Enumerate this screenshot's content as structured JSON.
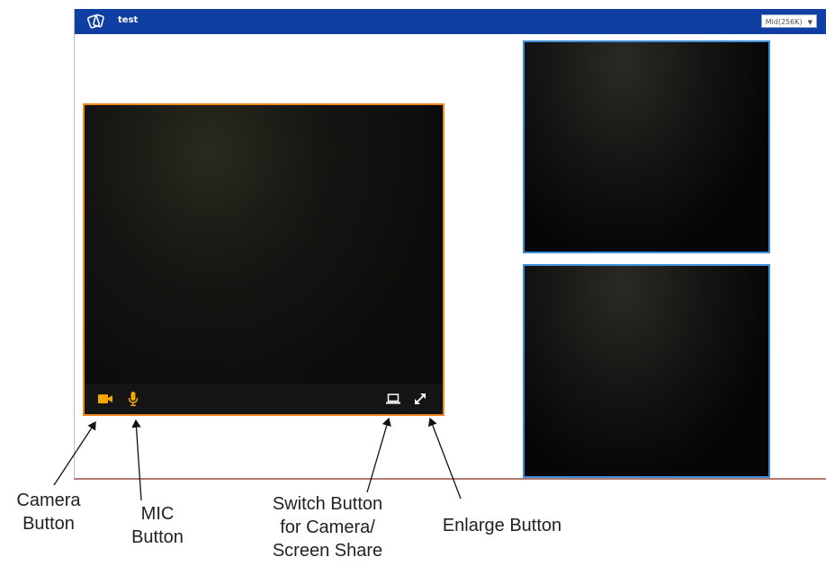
{
  "app": {
    "room_name": "test",
    "quality": "Mid(256K)",
    "colors": {
      "topbar": "#0f3fa3",
      "main_video_border": "#f08a1c",
      "side_video_border": "#3d8fd8",
      "control_icons": "#f5a800"
    }
  },
  "controls": {
    "camera_icon": "video-camera-icon",
    "mic_icon": "microphone-icon",
    "switch_icon": "laptop-icon",
    "enlarge_icon": "expand-arrows-icon"
  },
  "annotations": {
    "camera": "Camera\nButton",
    "mic": "MIC\nButton",
    "switch": "Switch Button\nfor Camera/\nScreen Share",
    "enlarge": "Enlarge Button"
  }
}
